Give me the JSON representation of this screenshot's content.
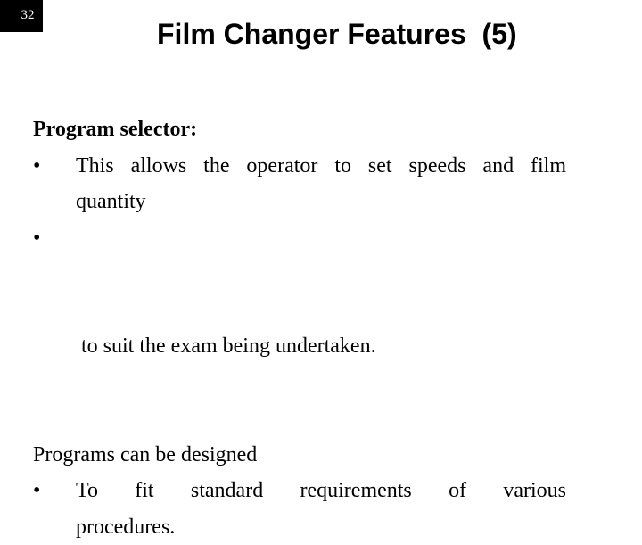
{
  "slide": {
    "number": "32",
    "title": "Film Changer Features  (5)",
    "heading": "Program selector:",
    "bullet_char": "•",
    "bullets_1": [
      {
        "line1": "This allows the operator to set speeds and film",
        "line2": "quantity"
      },
      {
        "line1": " to suit the exam being undertaken."
      }
    ],
    "subheading": "Programs can be designed",
    "bullets_2": [
      {
        "line1": "To fit standard requirements of various",
        "line2": "procedures."
      }
    ]
  }
}
